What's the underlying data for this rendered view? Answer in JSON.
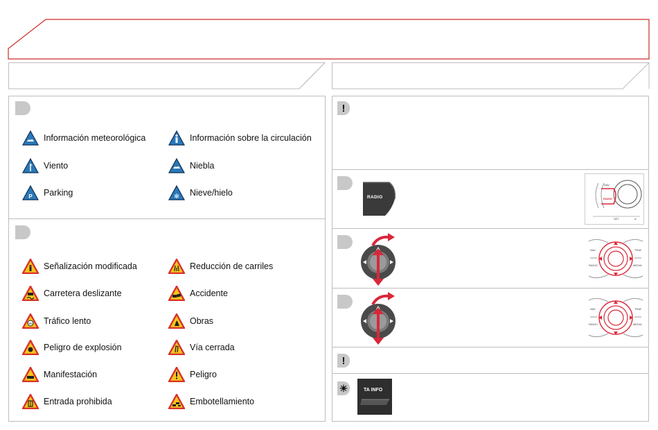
{
  "left_panel": {
    "info_items": [
      {
        "label": "Información meteorológica",
        "icon": "weather-info-icon"
      },
      {
        "label": "Información sobre la circulación",
        "icon": "traffic-info-icon"
      },
      {
        "label": "Viento",
        "icon": "wind-icon"
      },
      {
        "label": "Niebla",
        "icon": "fog-icon"
      },
      {
        "label": "Parking",
        "icon": "parking-icon"
      },
      {
        "label": "Nieve/hielo",
        "icon": "snow-ice-icon"
      }
    ],
    "warning_items": [
      {
        "label": "Señalización modificada",
        "icon": "modified-signals-icon"
      },
      {
        "label": "Reducción de carriles",
        "icon": "lane-reduction-icon"
      },
      {
        "label": "Carretera deslizante",
        "icon": "slippery-road-icon"
      },
      {
        "label": "Accidente",
        "icon": "accident-icon"
      },
      {
        "label": "Tráfico lento",
        "icon": "slow-traffic-icon"
      },
      {
        "label": "Obras",
        "icon": "roadworks-icon"
      },
      {
        "label": "Peligro de explosión",
        "icon": "explosion-hazard-icon"
      },
      {
        "label": "Vía cerrada",
        "icon": "road-closed-icon"
      },
      {
        "label": "Manifestación",
        "icon": "demonstration-icon"
      },
      {
        "label": "Peligro",
        "icon": "danger-icon"
      },
      {
        "label": "Entrada prohibida",
        "icon": "no-entry-icon"
      },
      {
        "label": "Embotellamiento",
        "icon": "traffic-jam-icon"
      }
    ]
  },
  "right_panel": {
    "radio_button_label": "RADIO",
    "ta_info_label": "TA INFO",
    "console_labels": {
      "nav": "NAV",
      "radio": "RADIO",
      "traf": "TRAF",
      "media": "MEDIA",
      "set": "SET",
      "a": "A"
    }
  },
  "colors": {
    "info_sign_blue": "#2a78b8",
    "warning_red": "#d8322b",
    "warning_yellow": "#f6c51a",
    "header_red": "#cc2a2a",
    "accent_arrow": "#d8283a"
  }
}
